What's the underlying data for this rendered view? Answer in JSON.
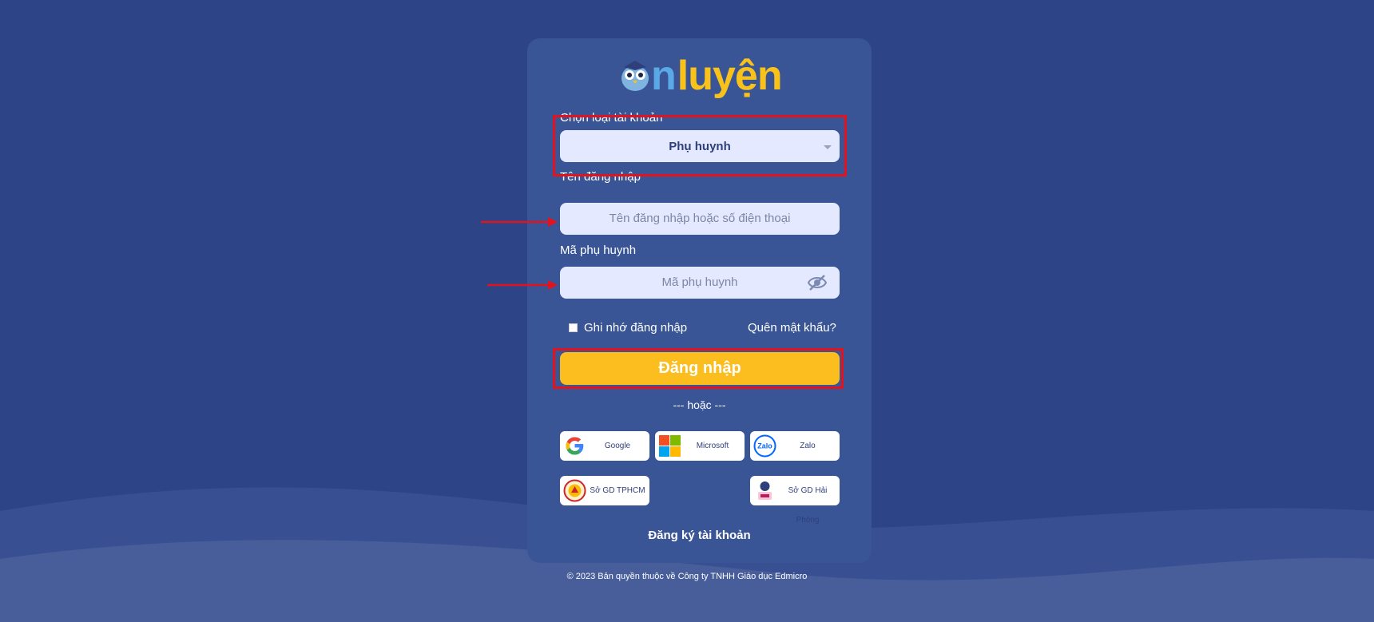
{
  "brand": {
    "logo_part1": "n",
    "logo_part2": "luyện"
  },
  "form": {
    "account_type_label": "Chọn loại tài khoản",
    "account_type_value": "Phụ huynh",
    "username_label": "Tên đăng nhập",
    "username_placeholder": "Tên đăng nhập hoặc số điện thoại",
    "parent_code_label": "Mã phụ huynh",
    "parent_code_placeholder": "Mã phụ huynh",
    "remember_label": "Ghi nhớ đăng nhập",
    "forgot_label": "Quên mật khẩu?",
    "login_label": "Đăng nhập",
    "or_label": "--- hoặc ---",
    "register_label": "Đăng ký tài khoản"
  },
  "social": {
    "google": "Google",
    "microsoft": "Microsoft",
    "zalo": "Zalo",
    "zalo_icon_text": "Zalo",
    "hcm": "Sở GD TPHCM",
    "haiphong": "Sở GD Hải Phòng"
  },
  "footer": {
    "copyright": "© 2023 Bản quyền thuộc về Công ty TNHH Giáo dục Edmicro"
  },
  "colors": {
    "background": "#2d4586",
    "card": "#3a5596",
    "login_button": "#fcbd1e",
    "highlight": "#e2131f"
  }
}
